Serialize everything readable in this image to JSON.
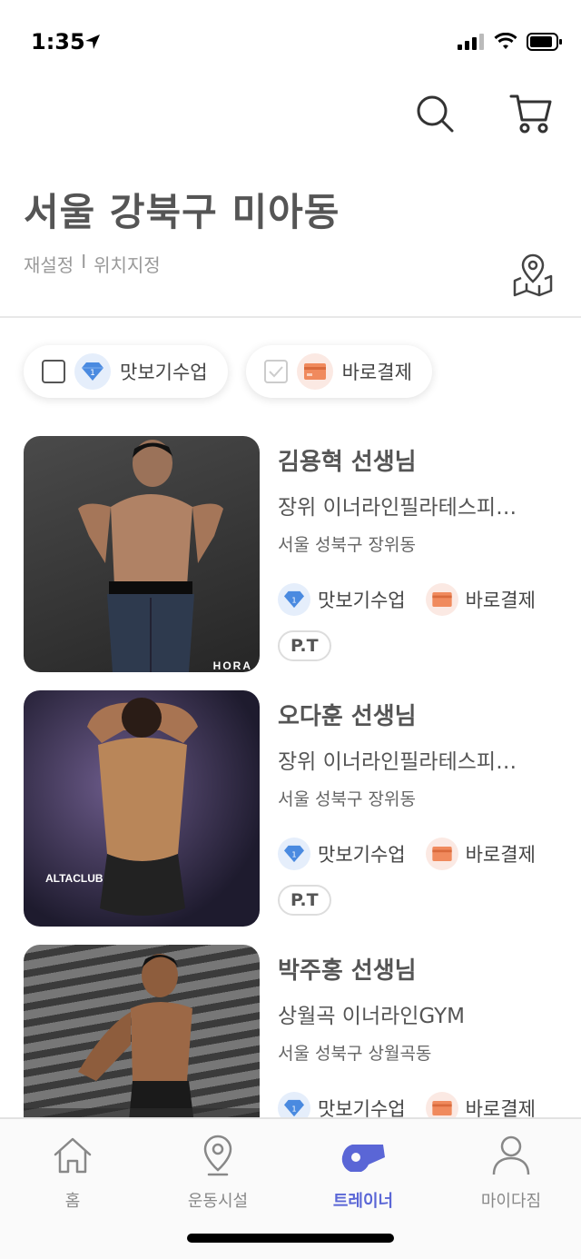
{
  "status": {
    "time": "1:35"
  },
  "header": {
    "location_title": "서울 강북구 미아동",
    "reset_label": "재설정",
    "separator": "I",
    "set_location_label": "위치지정"
  },
  "filters": [
    {
      "label": "맛보기수업",
      "checked": false,
      "badge": "diamond-icon",
      "color": "#4a8ae0"
    },
    {
      "label": "바로결제",
      "checked": false,
      "disabled": true,
      "badge": "card-icon",
      "color": "#f08a5d"
    }
  ],
  "trainers": [
    {
      "name": "김용혁 선생님",
      "gym": "장위 이너라인필라테스피…",
      "address": "서울 성북구 장위동",
      "tag1": "맛보기수업",
      "tag2": "바로결제",
      "pill": "P.T",
      "photo_logo": "HORA"
    },
    {
      "name": "오다훈 선생님",
      "gym": "장위 이너라인필라테스피…",
      "address": "서울 성북구 장위동",
      "tag1": "맛보기수업",
      "tag2": "바로결제",
      "pill": "P.T",
      "photo_logo": "ALTACLUB"
    },
    {
      "name": "박주홍 선생님",
      "gym": "상월곡 이너라인GYM",
      "address": "서울 성북구 상월곡동",
      "tag1": "맛보기수업",
      "tag2": "바로결제"
    }
  ],
  "tabbar": {
    "home": "홈",
    "facility": "운동시설",
    "trainer": "트레이너",
    "my": "마이다짐",
    "active": "trainer",
    "active_color": "#5a66d6"
  }
}
